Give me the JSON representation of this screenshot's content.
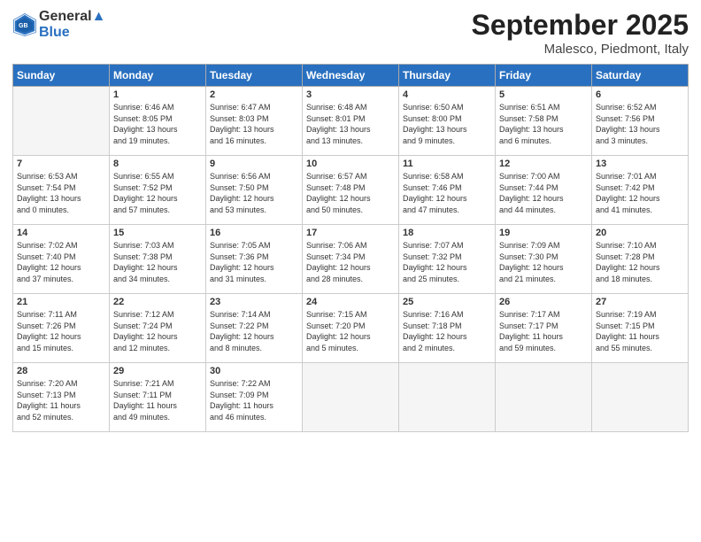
{
  "header": {
    "logo_line1": "General",
    "logo_line2": "Blue",
    "month": "September 2025",
    "location": "Malesco, Piedmont, Italy"
  },
  "days_of_week": [
    "Sunday",
    "Monday",
    "Tuesday",
    "Wednesday",
    "Thursday",
    "Friday",
    "Saturday"
  ],
  "weeks": [
    [
      {
        "day": "",
        "info": ""
      },
      {
        "day": "1",
        "info": "Sunrise: 6:46 AM\nSunset: 8:05 PM\nDaylight: 13 hours\nand 19 minutes."
      },
      {
        "day": "2",
        "info": "Sunrise: 6:47 AM\nSunset: 8:03 PM\nDaylight: 13 hours\nand 16 minutes."
      },
      {
        "day": "3",
        "info": "Sunrise: 6:48 AM\nSunset: 8:01 PM\nDaylight: 13 hours\nand 13 minutes."
      },
      {
        "day": "4",
        "info": "Sunrise: 6:50 AM\nSunset: 8:00 PM\nDaylight: 13 hours\nand 9 minutes."
      },
      {
        "day": "5",
        "info": "Sunrise: 6:51 AM\nSunset: 7:58 PM\nDaylight: 13 hours\nand 6 minutes."
      },
      {
        "day": "6",
        "info": "Sunrise: 6:52 AM\nSunset: 7:56 PM\nDaylight: 13 hours\nand 3 minutes."
      }
    ],
    [
      {
        "day": "7",
        "info": "Sunrise: 6:53 AM\nSunset: 7:54 PM\nDaylight: 13 hours\nand 0 minutes."
      },
      {
        "day": "8",
        "info": "Sunrise: 6:55 AM\nSunset: 7:52 PM\nDaylight: 12 hours\nand 57 minutes."
      },
      {
        "day": "9",
        "info": "Sunrise: 6:56 AM\nSunset: 7:50 PM\nDaylight: 12 hours\nand 53 minutes."
      },
      {
        "day": "10",
        "info": "Sunrise: 6:57 AM\nSunset: 7:48 PM\nDaylight: 12 hours\nand 50 minutes."
      },
      {
        "day": "11",
        "info": "Sunrise: 6:58 AM\nSunset: 7:46 PM\nDaylight: 12 hours\nand 47 minutes."
      },
      {
        "day": "12",
        "info": "Sunrise: 7:00 AM\nSunset: 7:44 PM\nDaylight: 12 hours\nand 44 minutes."
      },
      {
        "day": "13",
        "info": "Sunrise: 7:01 AM\nSunset: 7:42 PM\nDaylight: 12 hours\nand 41 minutes."
      }
    ],
    [
      {
        "day": "14",
        "info": "Sunrise: 7:02 AM\nSunset: 7:40 PM\nDaylight: 12 hours\nand 37 minutes."
      },
      {
        "day": "15",
        "info": "Sunrise: 7:03 AM\nSunset: 7:38 PM\nDaylight: 12 hours\nand 34 minutes."
      },
      {
        "day": "16",
        "info": "Sunrise: 7:05 AM\nSunset: 7:36 PM\nDaylight: 12 hours\nand 31 minutes."
      },
      {
        "day": "17",
        "info": "Sunrise: 7:06 AM\nSunset: 7:34 PM\nDaylight: 12 hours\nand 28 minutes."
      },
      {
        "day": "18",
        "info": "Sunrise: 7:07 AM\nSunset: 7:32 PM\nDaylight: 12 hours\nand 25 minutes."
      },
      {
        "day": "19",
        "info": "Sunrise: 7:09 AM\nSunset: 7:30 PM\nDaylight: 12 hours\nand 21 minutes."
      },
      {
        "day": "20",
        "info": "Sunrise: 7:10 AM\nSunset: 7:28 PM\nDaylight: 12 hours\nand 18 minutes."
      }
    ],
    [
      {
        "day": "21",
        "info": "Sunrise: 7:11 AM\nSunset: 7:26 PM\nDaylight: 12 hours\nand 15 minutes."
      },
      {
        "day": "22",
        "info": "Sunrise: 7:12 AM\nSunset: 7:24 PM\nDaylight: 12 hours\nand 12 minutes."
      },
      {
        "day": "23",
        "info": "Sunrise: 7:14 AM\nSunset: 7:22 PM\nDaylight: 12 hours\nand 8 minutes."
      },
      {
        "day": "24",
        "info": "Sunrise: 7:15 AM\nSunset: 7:20 PM\nDaylight: 12 hours\nand 5 minutes."
      },
      {
        "day": "25",
        "info": "Sunrise: 7:16 AM\nSunset: 7:18 PM\nDaylight: 12 hours\nand 2 minutes."
      },
      {
        "day": "26",
        "info": "Sunrise: 7:17 AM\nSunset: 7:17 PM\nDaylight: 11 hours\nand 59 minutes."
      },
      {
        "day": "27",
        "info": "Sunrise: 7:19 AM\nSunset: 7:15 PM\nDaylight: 11 hours\nand 55 minutes."
      }
    ],
    [
      {
        "day": "28",
        "info": "Sunrise: 7:20 AM\nSunset: 7:13 PM\nDaylight: 11 hours\nand 52 minutes."
      },
      {
        "day": "29",
        "info": "Sunrise: 7:21 AM\nSunset: 7:11 PM\nDaylight: 11 hours\nand 49 minutes."
      },
      {
        "day": "30",
        "info": "Sunrise: 7:22 AM\nSunset: 7:09 PM\nDaylight: 11 hours\nand 46 minutes."
      },
      {
        "day": "",
        "info": ""
      },
      {
        "day": "",
        "info": ""
      },
      {
        "day": "",
        "info": ""
      },
      {
        "day": "",
        "info": ""
      }
    ]
  ]
}
